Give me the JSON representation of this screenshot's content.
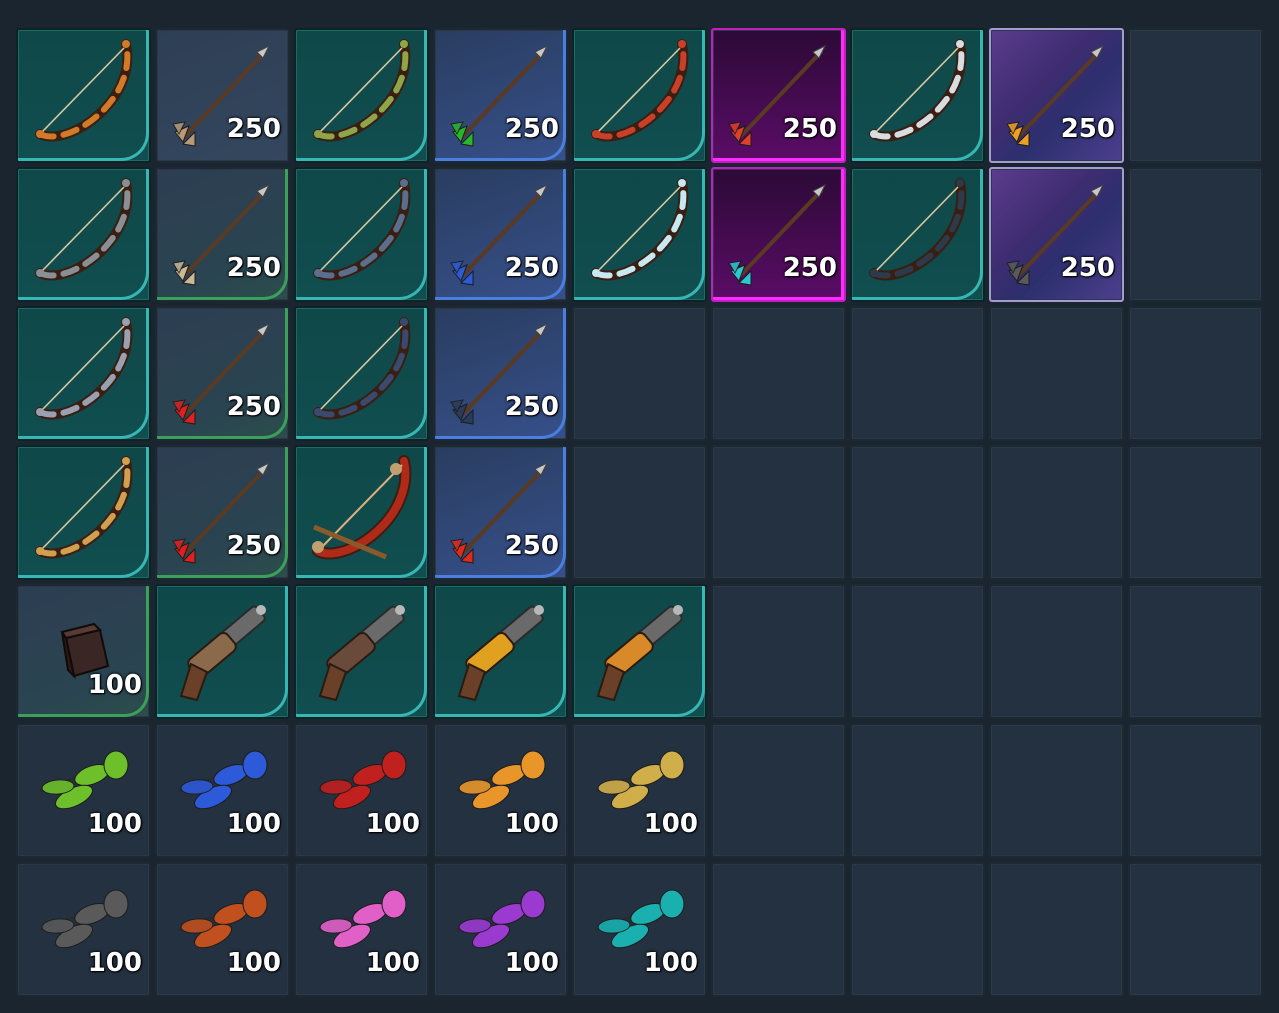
{
  "inventory": {
    "rows": [
      [
        {
          "name": "bow",
          "variant": "teal",
          "icon": "bow-icon",
          "color": "#d07a2a",
          "qty": ""
        },
        {
          "name": "arrow",
          "variant": "grey",
          "icon": "arrow-icon",
          "color": "#b89a78",
          "qty": "250"
        },
        {
          "name": "bow",
          "variant": "teal",
          "icon": "bow-icon",
          "color": "#8ea54a",
          "qty": ""
        },
        {
          "name": "arrow",
          "variant": "blue",
          "icon": "arrow-icon",
          "color": "#27b82a",
          "qty": "250"
        },
        {
          "name": "bow",
          "variant": "teal",
          "icon": "bow-icon",
          "color": "#c8402a",
          "qty": ""
        },
        {
          "name": "arrow",
          "variant": "magenta",
          "icon": "arrow-icon",
          "color": "#e0402a",
          "qty": "250"
        },
        {
          "name": "bow",
          "variant": "teal",
          "icon": "bow-icon",
          "color": "#d8dde2",
          "qty": ""
        },
        {
          "name": "arrow",
          "variant": "violet",
          "icon": "arrow-icon",
          "color": "#f0a020",
          "qty": "250"
        },
        {
          "name": "empty",
          "variant": "empty",
          "icon": "",
          "color": "",
          "qty": ""
        }
      ],
      [
        {
          "name": "bow",
          "variant": "teal",
          "icon": "bow-icon",
          "color": "#8a8f96",
          "qty": ""
        },
        {
          "name": "arrow",
          "variant": "grey-green",
          "icon": "arrow-icon",
          "color": "#c8b898",
          "qty": "250"
        },
        {
          "name": "bow",
          "variant": "teal",
          "icon": "bow-icon",
          "color": "#5a6f8e",
          "qty": ""
        },
        {
          "name": "arrow",
          "variant": "blue",
          "icon": "arrow-icon",
          "color": "#2c5ad8",
          "qty": "250"
        },
        {
          "name": "bow",
          "variant": "teal",
          "icon": "bow-icon",
          "color": "#c8e8f2",
          "qty": ""
        },
        {
          "name": "arrow",
          "variant": "magenta",
          "icon": "arrow-icon",
          "color": "#2ac8d0",
          "qty": "250"
        },
        {
          "name": "bow",
          "variant": "teal",
          "icon": "bow-icon",
          "color": "#2c3a4a",
          "qty": ""
        },
        {
          "name": "arrow",
          "variant": "violet",
          "icon": "arrow-icon",
          "color": "#5a5a5a",
          "qty": "250"
        },
        {
          "name": "empty",
          "variant": "empty",
          "icon": "",
          "color": "",
          "qty": ""
        }
      ],
      [
        {
          "name": "bow",
          "variant": "teal",
          "icon": "bow-icon",
          "color": "#9aa0b0",
          "qty": ""
        },
        {
          "name": "arrow",
          "variant": "grey-green",
          "icon": "arrow-icon",
          "color": "#e02020",
          "qty": "250"
        },
        {
          "name": "bow",
          "variant": "teal",
          "icon": "bow-icon",
          "color": "#3a4a6e",
          "qty": ""
        },
        {
          "name": "arrow",
          "variant": "blue",
          "icon": "arrow-icon",
          "color": "#2c3a5a",
          "qty": "250"
        },
        {
          "name": "empty",
          "variant": "empty",
          "icon": "",
          "color": "",
          "qty": ""
        },
        {
          "name": "empty",
          "variant": "empty",
          "icon": "",
          "color": "",
          "qty": ""
        },
        {
          "name": "empty",
          "variant": "empty",
          "icon": "",
          "color": "",
          "qty": ""
        },
        {
          "name": "empty",
          "variant": "empty",
          "icon": "",
          "color": "",
          "qty": ""
        },
        {
          "name": "empty",
          "variant": "empty",
          "icon": "",
          "color": "",
          "qty": ""
        }
      ],
      [
        {
          "name": "bow",
          "variant": "teal",
          "icon": "bow-icon",
          "color": "#d0a050",
          "qty": ""
        },
        {
          "name": "arrow",
          "variant": "grey-green",
          "icon": "arrow-icon",
          "color": "#e02020",
          "qty": "250"
        },
        {
          "name": "bow",
          "variant": "teal",
          "icon": "crossbow-icon",
          "color": "#b02a1a",
          "qty": ""
        },
        {
          "name": "arrow",
          "variant": "blue",
          "icon": "arrow-icon",
          "color": "#e02a1a",
          "qty": "250"
        },
        {
          "name": "empty",
          "variant": "empty",
          "icon": "",
          "color": "",
          "qty": ""
        },
        {
          "name": "empty",
          "variant": "empty",
          "icon": "",
          "color": "",
          "qty": ""
        },
        {
          "name": "empty",
          "variant": "empty",
          "icon": "",
          "color": "",
          "qty": ""
        },
        {
          "name": "empty",
          "variant": "empty",
          "icon": "",
          "color": "",
          "qty": ""
        },
        {
          "name": "empty",
          "variant": "empty",
          "icon": "",
          "color": "",
          "qty": ""
        }
      ],
      [
        {
          "name": "cube",
          "variant": "grey-green",
          "icon": "cube-icon",
          "color": "#3a2624",
          "qty": "100"
        },
        {
          "name": "pistol",
          "variant": "teal",
          "icon": "pistol-icon",
          "color": "#8a6a4a",
          "qty": ""
        },
        {
          "name": "pistol",
          "variant": "teal",
          "icon": "pistol-icon",
          "color": "#6a4a3a",
          "qty": ""
        },
        {
          "name": "pistol",
          "variant": "teal",
          "icon": "pistol-icon",
          "color": "#e0a020",
          "qty": ""
        },
        {
          "name": "pistol",
          "variant": "teal",
          "icon": "pistol-icon",
          "color": "#d88a2a",
          "qty": ""
        },
        {
          "name": "empty",
          "variant": "empty",
          "icon": "",
          "color": "",
          "qty": ""
        },
        {
          "name": "empty",
          "variant": "empty",
          "icon": "",
          "color": "",
          "qty": ""
        },
        {
          "name": "empty",
          "variant": "empty",
          "icon": "",
          "color": "",
          "qty": ""
        },
        {
          "name": "empty",
          "variant": "empty",
          "icon": "",
          "color": "",
          "qty": ""
        }
      ],
      [
        {
          "name": "feathers",
          "variant": "empty",
          "icon": "feather-icon",
          "color": "#6ec02a",
          "qty": "100"
        },
        {
          "name": "feathers",
          "variant": "empty",
          "icon": "feather-icon",
          "color": "#2c5ad8",
          "qty": "100"
        },
        {
          "name": "feathers",
          "variant": "empty",
          "icon": "feather-icon",
          "color": "#c0201e",
          "qty": "100"
        },
        {
          "name": "feathers",
          "variant": "empty",
          "icon": "feather-icon",
          "color": "#e8962a",
          "qty": "100"
        },
        {
          "name": "feathers",
          "variant": "empty",
          "icon": "feather-icon",
          "color": "#d0ae4a",
          "qty": "100"
        },
        {
          "name": "empty",
          "variant": "empty",
          "icon": "",
          "color": "",
          "qty": ""
        },
        {
          "name": "empty",
          "variant": "empty",
          "icon": "",
          "color": "",
          "qty": ""
        },
        {
          "name": "empty",
          "variant": "empty",
          "icon": "",
          "color": "",
          "qty": ""
        },
        {
          "name": "empty",
          "variant": "empty",
          "icon": "",
          "color": "",
          "qty": ""
        }
      ],
      [
        {
          "name": "feathers",
          "variant": "empty",
          "icon": "feather-icon",
          "color": "#5a5a5a",
          "qty": "100"
        },
        {
          "name": "feathers",
          "variant": "empty",
          "icon": "feather-icon",
          "color": "#c0501e",
          "qty": "100"
        },
        {
          "name": "feathers",
          "variant": "empty",
          "icon": "feather-icon",
          "color": "#e060c8",
          "qty": "100"
        },
        {
          "name": "feathers",
          "variant": "empty",
          "icon": "feather-icon",
          "color": "#9a3ad0",
          "qty": "100"
        },
        {
          "name": "feathers",
          "variant": "empty",
          "icon": "feather-icon",
          "color": "#1ab0b0",
          "qty": "100"
        },
        {
          "name": "empty",
          "variant": "empty",
          "icon": "",
          "color": "",
          "qty": ""
        },
        {
          "name": "empty",
          "variant": "empty",
          "icon": "",
          "color": "",
          "qty": ""
        },
        {
          "name": "empty",
          "variant": "empty",
          "icon": "",
          "color": "",
          "qty": ""
        },
        {
          "name": "empty",
          "variant": "empty",
          "icon": "",
          "color": "",
          "qty": ""
        }
      ]
    ]
  }
}
